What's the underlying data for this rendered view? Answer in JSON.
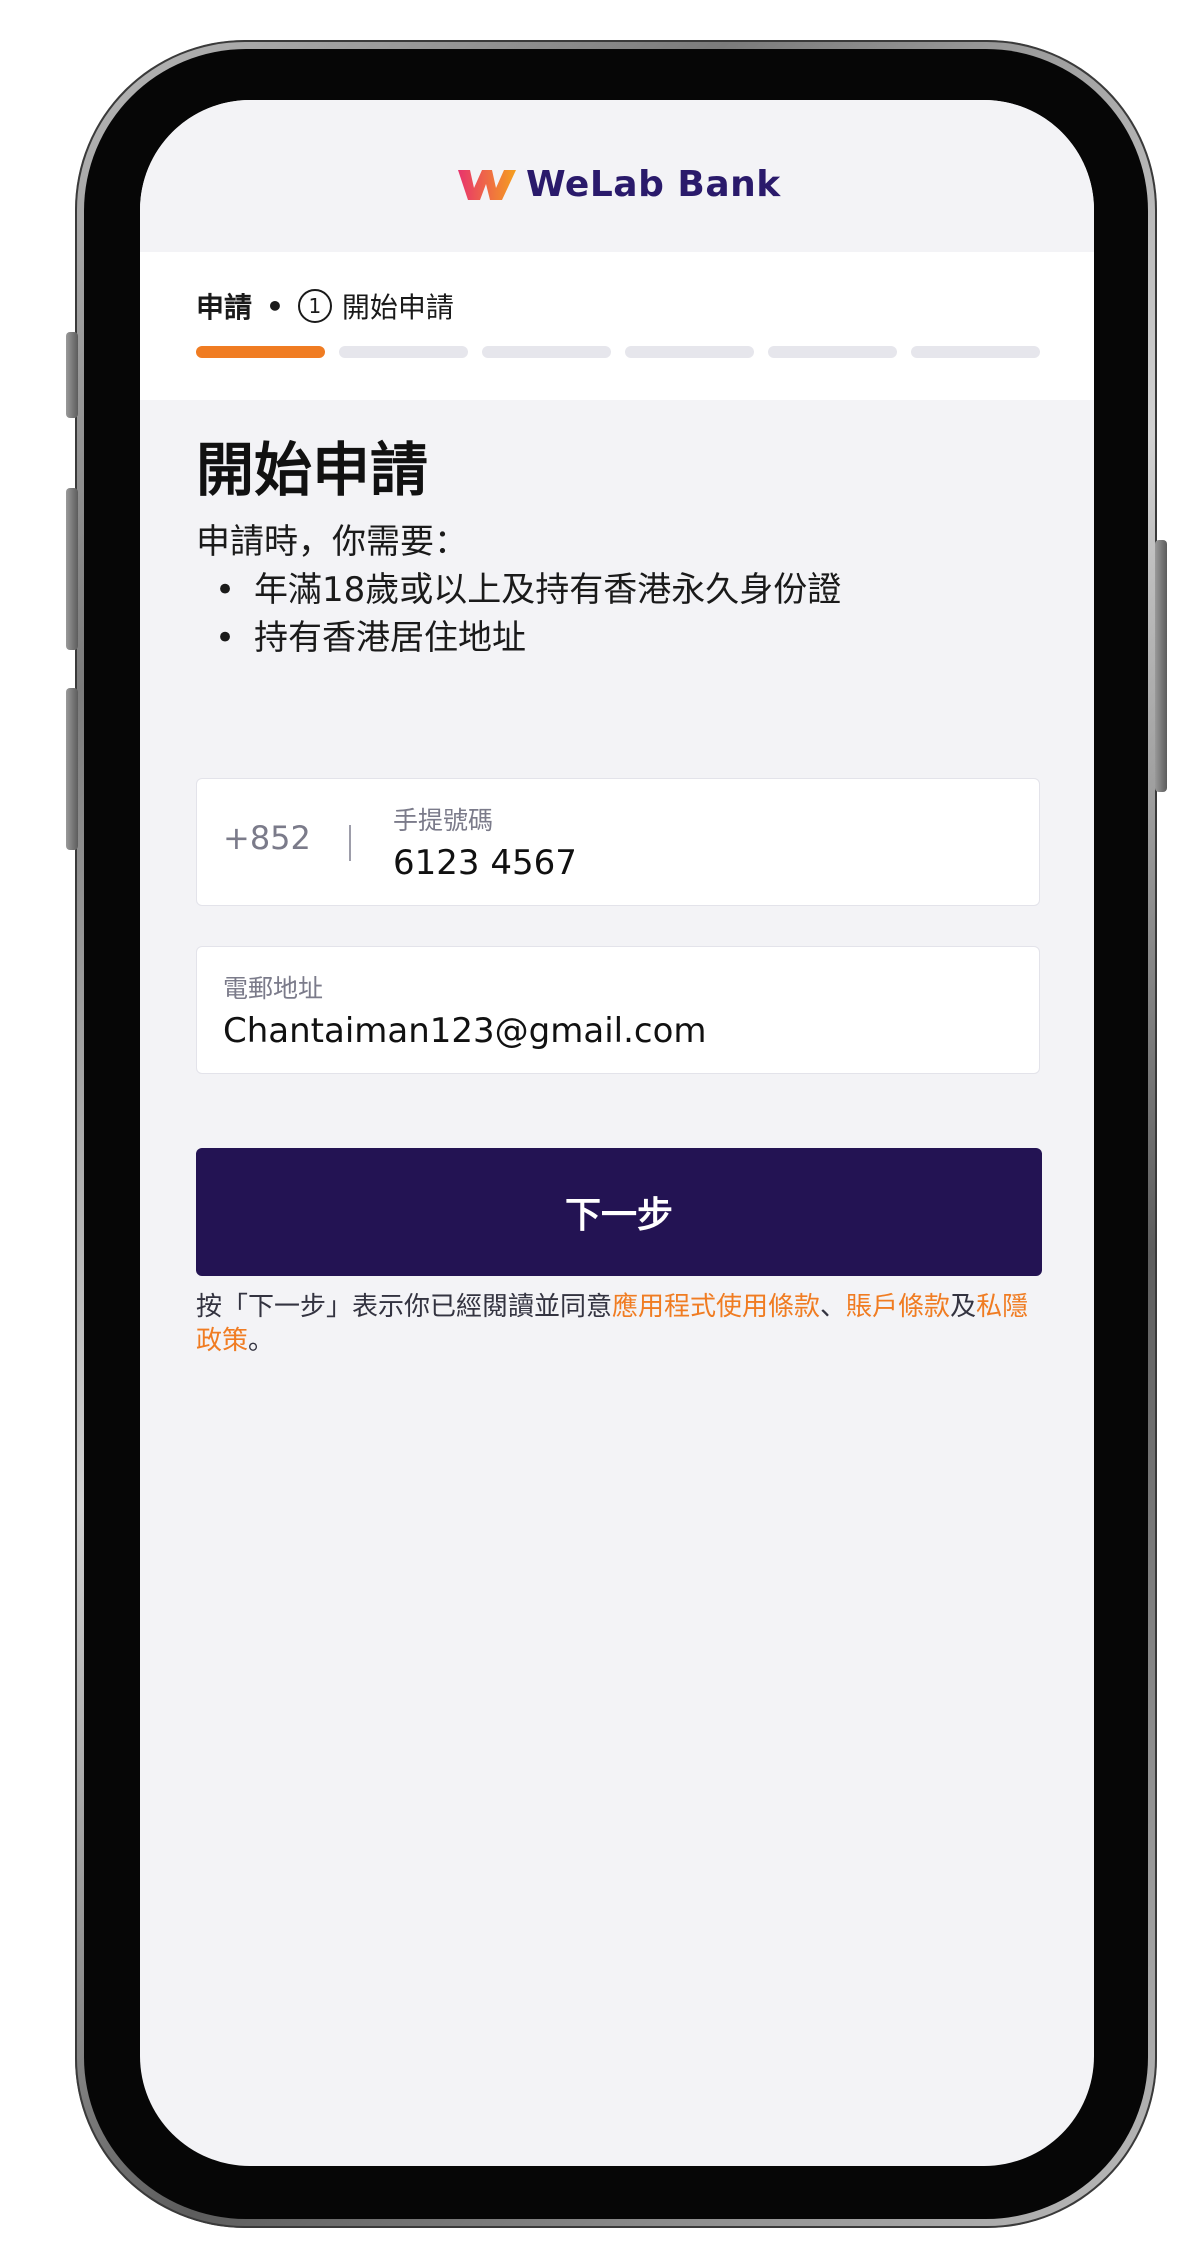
{
  "brand": {
    "name": "WeLab Bank",
    "logo_colors": [
      "#f5821f",
      "#e8336d"
    ]
  },
  "progress": {
    "category": "申請",
    "separator": "•",
    "step_number": "1",
    "step_title": "開始申請",
    "total_steps": 6,
    "current_step": 1
  },
  "page": {
    "title": "開始申請",
    "intro": "申請時，你需要：",
    "requirements": [
      "年滿18歲或以上及持有香港永久身份證",
      "持有香港居住地址"
    ]
  },
  "phone_field": {
    "country_code": "+852",
    "label": "手提號碼",
    "value": "6123 4567"
  },
  "email_field": {
    "label": "電郵地址",
    "value": "Chantaiman123@gmail.com"
  },
  "next_button": {
    "label": "下一步"
  },
  "terms": {
    "prefix": "按「下一步」表示你已經閱讀並同意",
    "link_app_terms": "應用程式使用條款",
    "sep1": "、",
    "link_account_terms": "賬戶條款",
    "sep2": "及",
    "link_privacy": "私隱政策",
    "suffix": "。"
  },
  "colors": {
    "accent": "#f07c22",
    "primary": "#231353",
    "brand_text": "#2a1a6b"
  }
}
